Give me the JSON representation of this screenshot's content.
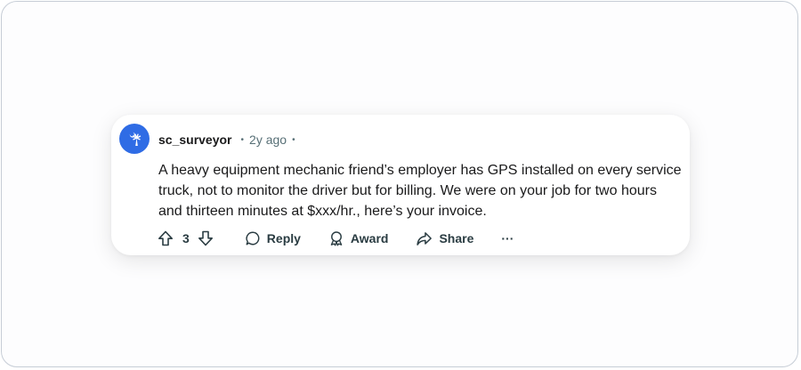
{
  "comment": {
    "author": "sc_surveyor",
    "separator": "•",
    "time_ago": "2y ago",
    "body": "A heavy equipment mechanic friend’s employer has GPS installed on every service truck, not to monitor the driver but for billing. We were on your job for two hours and thirteen minutes at $xxx/hr., here’s your invoice.",
    "avatar_color": "#2f6ce5"
  },
  "actions": {
    "vote_count": "3",
    "reply_label": "Reply",
    "award_label": "Award",
    "share_label": "Share",
    "more_label": "···"
  },
  "icons": {
    "upvote": "arrow-up-icon",
    "downvote": "arrow-down-icon",
    "reply": "speech-bubble-icon",
    "award": "award-ribbon-icon",
    "share": "share-arrow-icon",
    "avatar": "palmetto-tree-icon"
  }
}
